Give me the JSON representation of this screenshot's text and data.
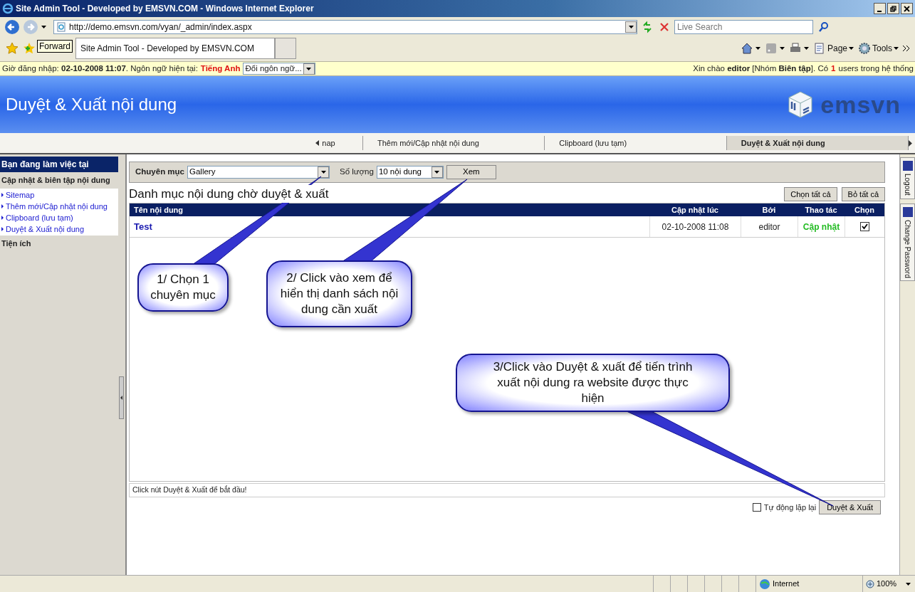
{
  "window": {
    "title": "Site Admin Tool - Developed by EMSVN.COM - Windows Internet Explorer"
  },
  "address_bar": {
    "url": "http://demo.emsvn.com/vyan/_admin/index.aspx"
  },
  "search": {
    "placeholder": "Live Search"
  },
  "tooltip": "Forward",
  "browser_tab": {
    "title": "Site Admin Tool - Developed by EMSVN.COM"
  },
  "command_bar": [
    {
      "kind": "home"
    },
    {
      "kind": "feeds"
    },
    {
      "kind": "print"
    },
    {
      "kind": "page",
      "label": "Page"
    },
    {
      "kind": "tools",
      "label": "Tools"
    }
  ],
  "info_bar": {
    "login": "Giờ đăng nhập: **02-10-2008 11:07**. Ngôn ngữ hiện tại:",
    "language": "Tiếng Anh",
    "language_select": "Đổi ngôn ngữ...",
    "greeting": "Xin chào **editor** [Nhóm **Biên tập**]. Có",
    "user_count": "1",
    "users_suffix": "users trong hệ thống"
  },
  "header": {
    "title": "Duyệt & Xuất nội dung",
    "logo": "emsvn"
  },
  "nav_tabs": [
    {
      "label": "nap",
      "selected": false
    },
    {
      "label": "Thêm mới/Cập nhật nội dung",
      "selected": false
    },
    {
      "label": "Clipboard (lưu tạm)",
      "selected": false
    },
    {
      "label": "Duyệt & Xuất nội dung",
      "selected": true
    }
  ],
  "sidebar": {
    "title": "Bạn đang làm việc tại",
    "sections": [
      {
        "title": "Cập nhật & biên tập nội dung",
        "items": [
          "Sitemap",
          "Thêm mới/Cập nhật nội dung",
          "Clipboard (lưu tạm)",
          "Duyệt & Xuất nội dung"
        ]
      },
      {
        "title": "Tiện ích"
      }
    ]
  },
  "filter": {
    "category_label": "Chuyên mục",
    "category_value": "Gallery",
    "quantity_label": "Số lượng",
    "quantity_value": "10 nội dung",
    "view_button": "Xem"
  },
  "list": {
    "title": "Danh mục nội dung chờ duyệt & xuất",
    "buttons": [
      "Chọn tất cả",
      "Bỏ tất cả"
    ]
  },
  "table": {
    "columns": [
      "Tên nội dung",
      "Cập nhật lúc",
      "Bởi",
      "Thao tác",
      "Chọn"
    ],
    "rows": [
      {
        "title": "Test",
        "updated": "02-10-2008 11:08",
        "by": "editor",
        "action": "Cập nhật",
        "checked": true
      }
    ]
  },
  "status_message": "Click nút Duyệt & Xuất để bắt đầu!",
  "auto_repeat": {
    "label": "Tự động lặp lại",
    "checked": false
  },
  "submit_button": "Duyệt & Xuất",
  "right_tabs": [
    "Logout",
    "Change Password"
  ],
  "callouts": [
    {
      "text": "1/ Chọn 1 chuyên mục"
    },
    {
      "text": "2/ Click vào xem để hiển thị danh sách nội dung cần xuất"
    },
    {
      "text": "3/Click vào Duyệt & xuất để tiến trình xuất nội dung ra website được thực hiện"
    }
  ],
  "status_bar": {
    "zone": "Internet",
    "zoom": "100%"
  }
}
